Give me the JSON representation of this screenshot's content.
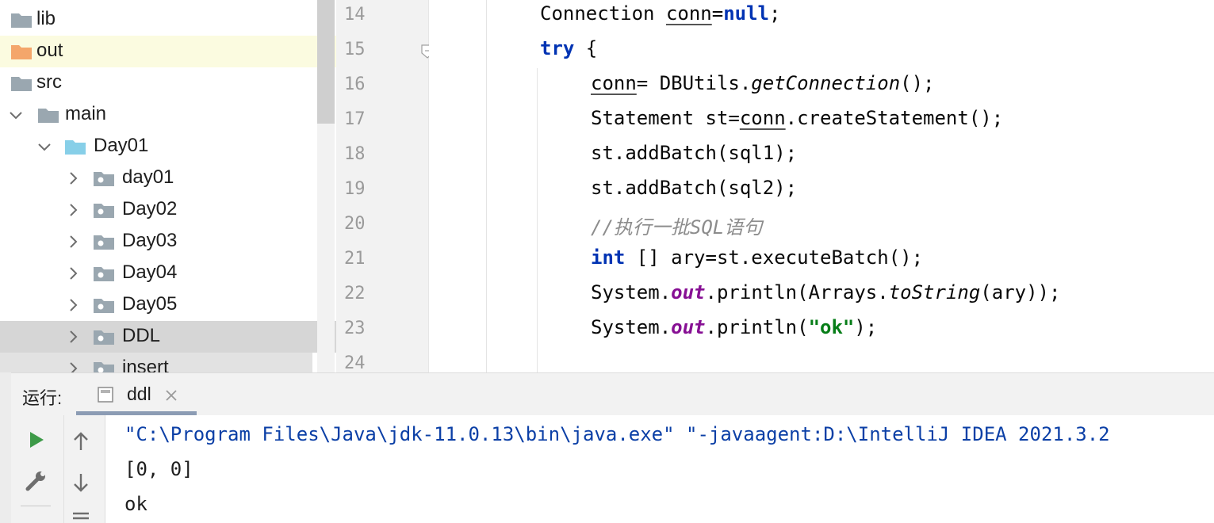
{
  "project_tree": {
    "items": [
      {
        "label": "lib",
        "icon": "folder-icon"
      },
      {
        "label": "out",
        "icon": "folder-orange-icon"
      },
      {
        "label": "src",
        "icon": "folder-icon"
      },
      {
        "label": "main",
        "icon": "folder-icon"
      },
      {
        "label": "Day01",
        "icon": "folder-blue-icon"
      },
      {
        "label": "day01",
        "icon": "package-icon"
      },
      {
        "label": "Day02",
        "icon": "package-icon"
      },
      {
        "label": "Day03",
        "icon": "package-icon"
      },
      {
        "label": "Day04",
        "icon": "package-icon"
      },
      {
        "label": "Day05",
        "icon": "package-icon"
      },
      {
        "label": "DDL",
        "icon": "package-icon"
      },
      {
        "label": "insert",
        "icon": "package-icon"
      }
    ]
  },
  "editor": {
    "line_numbers": [
      "14",
      "15",
      "16",
      "17",
      "18",
      "19",
      "20",
      "21",
      "22",
      "23",
      "24"
    ],
    "lines": {
      "l14": {
        "type": "Connection ",
        "var": "conn",
        "eq": "=",
        "kw": "null",
        "end": ";"
      },
      "l15": {
        "kw": "try",
        "rest": " {"
      },
      "l16": {
        "var": "conn",
        "a": "= DBUtils.",
        "m": "getConnection",
        "b": "();"
      },
      "l17": {
        "a": "Statement st=",
        "var": "conn",
        "b": ".createStatement();"
      },
      "l18": "st.addBatch(sql1);",
      "l19": "st.addBatch(sql2);",
      "l20": "//执行一批SQL语句",
      "l21": {
        "kw": "int",
        "rest": " [] ary=st.executeBatch();"
      },
      "l22": {
        "a": "System.",
        "f": "out",
        "b": ".println(Arrays.",
        "m": "toString",
        "c": "(ary));"
      },
      "l23": {
        "a": "System.",
        "f": "out",
        "b": ".println(",
        "s": "\"ok\"",
        "c": ");"
      }
    }
  },
  "run_panel": {
    "label": "运行:",
    "tab_name": "ddl",
    "console_lines": [
      "\"C:\\Program Files\\Java\\jdk-11.0.13\\bin\\java.exe\" \"-javaagent:D:\\IntelliJ IDEA 2021.3.2",
      "[0, 0]",
      "ok"
    ],
    "colors": {
      "command": "#0b3fa6",
      "output": "#1e1e1e",
      "run": "#3d9a48"
    }
  }
}
